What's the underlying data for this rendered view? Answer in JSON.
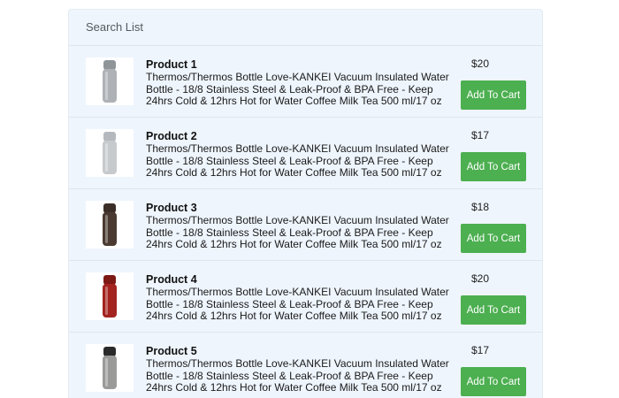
{
  "list": {
    "title": "Search List",
    "products": [
      {
        "name": "Product 1",
        "description": "Thermos/Thermos Bottle Love-KANKEI Vacuum Insulated Water Bottle - 18/8 Stainless Steel & Leak-Proof & BPA Free - Keep 24hrs Cold & 12hrs Hot for Water Coffee Milk Tea 500 ml/17 oz",
        "price": "$20",
        "button_label": "Add To Cart",
        "bottle_color": "#aeb2b6",
        "cap_color": "#8f9499"
      },
      {
        "name": "Product 2",
        "description": "Thermos/Thermos Bottle Love-KANKEI Vacuum Insulated Water Bottle - 18/8 Stainless Steel & Leak-Proof & BPA Free - Keep 24hrs Cold & 12hrs Hot for Water Coffee Milk Tea 500 ml/17 oz",
        "price": "$17",
        "button_label": "Add To Cart",
        "bottle_color": "#c7cacd",
        "cap_color": "#b5b9bd"
      },
      {
        "name": "Product 3",
        "description": "Thermos/Thermos Bottle Love-KANKEI Vacuum Insulated Water Bottle - 18/8 Stainless Steel & Leak-Proof & BPA Free - Keep 24hrs Cold & 12hrs Hot for Water Coffee Milk Tea 500 ml/17 oz",
        "price": "$18",
        "button_label": "Add To Cart",
        "bottle_color": "#4a3a32",
        "cap_color": "#3b2d27"
      },
      {
        "name": "Product 4",
        "description": "Thermos/Thermos Bottle Love-KANKEI Vacuum Insulated Water Bottle - 18/8 Stainless Steel & Leak-Proof & BPA Free - Keep 24hrs Cold & 12hrs Hot for Water Coffee Milk Tea 500 ml/17 oz",
        "price": "$20",
        "button_label": "Add To Cart",
        "bottle_color": "#a3231f",
        "cap_color": "#7e1815"
      },
      {
        "name": "Product 5",
        "description": "Thermos/Thermos Bottle Love-KANKEI Vacuum Insulated Water Bottle - 18/8 Stainless Steel & Leak-Proof & BPA Free - Keep 24hrs Cold & 12hrs Hot for Water Coffee Milk Tea 500 ml/17 oz",
        "price": "$17",
        "button_label": "Add To Cart",
        "bottle_color": "#9a9b98",
        "cap_color": "#2a2a2a"
      }
    ]
  },
  "colors": {
    "accent_button": "#4caf50",
    "panel_background": "#eef5fd"
  }
}
